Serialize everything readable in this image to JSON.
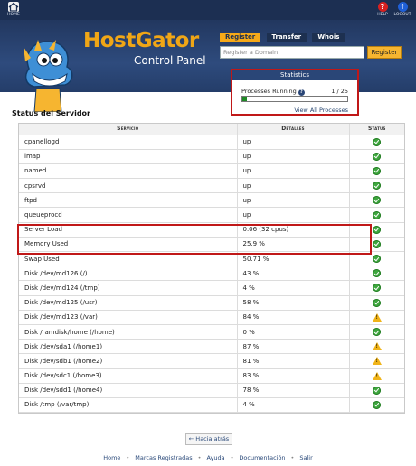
{
  "topbar": {
    "home_label": "HOME",
    "help_label": "HELP",
    "logout_label": "LOGOUT"
  },
  "header": {
    "brand": "HostGator",
    "subtitle": "Control Panel",
    "tabs": [
      "Register",
      "Transfer",
      "Whois"
    ],
    "domain_placeholder": "Register a Domain",
    "register_button": "Register"
  },
  "statistics": {
    "title": "Statistics",
    "processes_label": "Processes Running",
    "processes_count": "1 / 25",
    "processes_fraction": 0.04,
    "link": "View All Processes"
  },
  "server_status": {
    "title": "Status del Servidor",
    "columns": [
      "Servicio",
      "Detalles",
      "Status"
    ],
    "rows": [
      {
        "service": "cpanellogd",
        "details": "up",
        "status": "ok"
      },
      {
        "service": "imap",
        "details": "up",
        "status": "ok"
      },
      {
        "service": "named",
        "details": "up",
        "status": "ok"
      },
      {
        "service": "cpsrvd",
        "details": "up",
        "status": "ok"
      },
      {
        "service": "ftpd",
        "details": "up",
        "status": "ok"
      },
      {
        "service": "queueprocd",
        "details": "up",
        "status": "ok"
      },
      {
        "service": "Server Load",
        "details": "0.06 (32 cpus)",
        "status": "ok"
      },
      {
        "service": "Memory Used",
        "details": "25.9 %",
        "status": "ok"
      },
      {
        "service": "Swap Used",
        "details": "50.71 %",
        "status": "ok"
      },
      {
        "service": "Disk /dev/md126 (/)",
        "details": "43 %",
        "status": "ok"
      },
      {
        "service": "Disk /dev/md124 (/tmp)",
        "details": "4 %",
        "status": "ok"
      },
      {
        "service": "Disk /dev/md125 (/usr)",
        "details": "58 %",
        "status": "ok"
      },
      {
        "service": "Disk /dev/md123 (/var)",
        "details": "84 %",
        "status": "warning"
      },
      {
        "service": "Disk /ramdisk/home (/home)",
        "details": "0 %",
        "status": "ok"
      },
      {
        "service": "Disk /dev/sda1 (/home1)",
        "details": "87 %",
        "status": "warning"
      },
      {
        "service": "Disk /dev/sdb1 (/home2)",
        "details": "81 %",
        "status": "warning"
      },
      {
        "service": "Disk /dev/sdc1 (/home3)",
        "details": "83 %",
        "status": "warning"
      },
      {
        "service": "Disk /dev/sdd1 (/home4)",
        "details": "78 %",
        "status": "ok"
      },
      {
        "service": "Disk /tmp (/var/tmp)",
        "details": "4 %",
        "status": "ok"
      }
    ]
  },
  "back_button": "← Hacia atrás",
  "footer": {
    "links": [
      "Home",
      "Marcas Registradas",
      "Ayuda",
      "Documentación",
      "Salir"
    ]
  },
  "colors": {
    "header_bg": "#2e4b7d",
    "brand_orange": "#f0a616",
    "highlight_red": "#c01818",
    "ok_green": "#3ea63e",
    "warn_yellow": "#f0b419"
  }
}
